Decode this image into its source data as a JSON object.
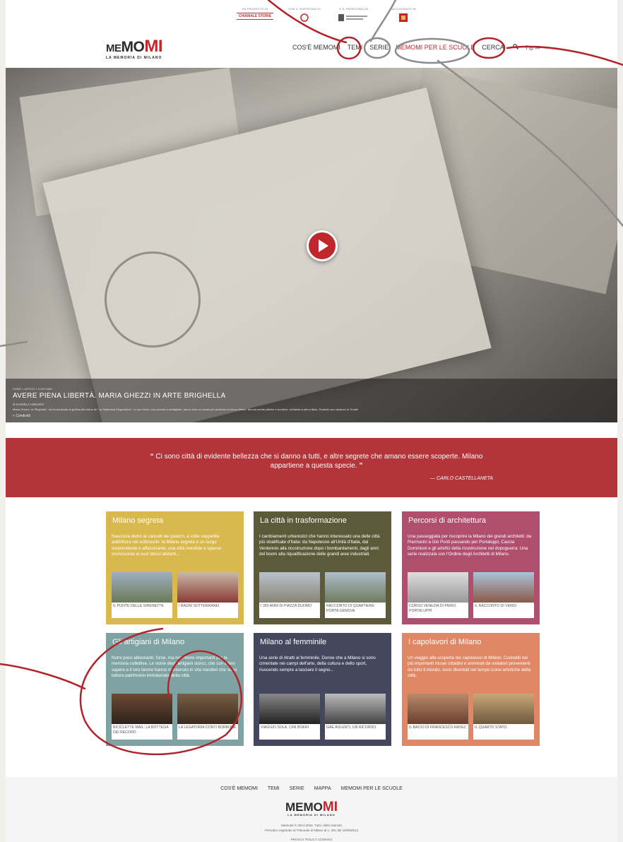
{
  "sponsors": [
    {
      "label": "UN PROGETTO DI",
      "logo": "CHIAMALE STORIE"
    },
    {
      "label": "CON IL SOSTEGNO DI",
      "logo": ""
    },
    {
      "label": "E IL PATROCINIO DI",
      "logo": ""
    },
    {
      "label": "SELEZIONATO IN",
      "logo": ""
    }
  ],
  "brand": {
    "me": "ME",
    "mo": "MO",
    "mi": "MI",
    "subtitle": "LA MEMORIA DI MILANO"
  },
  "nav": {
    "items": [
      "COS'È MEMOMI",
      "TEMI",
      "SERIE",
      "MEMOMI PER LE SCUOLE",
      "CERCA"
    ]
  },
  "hero": {
    "crumbs": "HOME  »  ARTISTI  »  COSTUME",
    "title": "AVERE PIENA LIBERTÀ. MARIA GHEZZI IN ARTE BRIGHELLA",
    "byline": "di DANIELA ANNARO",
    "excerpt": "Maria Ghezzi, la \"Brighella\", ha rivoluzionato la grafica dei rebus de \"La Settimana Enigmistica\". Le sue chine, così precise e dettagliate, hanno dato un senso più profondo al rebus stesso. Ma era anche pittrice e scultrice: un'artista a pieno titolo. Durante una vacanza in Trentin",
    "share": "Condividi"
  },
  "quote": {
    "text": "Ci sono città di evidente bellezza che si danno a tutti, e altre segrete che amano essere scoperte. Milano appartiene a questa specie.",
    "author": "— CARLO CASTELLANETA"
  },
  "cards": [
    {
      "title": "Milano segreta",
      "color": "#d9b84e",
      "desc": "Nascosta dietro ai cancelli dei palazzi, a volte seppellita addirittura nel sottosuolo: la Milano segreta è un luogo sorprendente e affascinante, una città invisibile e spesso sconosciuta ai suoi stessi abitanti...",
      "thumbs": [
        "IL PONTE DELLE SIRENETTE",
        "I BAGNI SOTTERRANEI"
      ]
    },
    {
      "title": "La città in trasformazione",
      "color": "#5d5a3a",
      "desc": "I cambiamenti urbanistici che hanno interessato una delle città più stratificate d'Italia: da Napoleone all'Unità d'Italia, dal Ventennio alla ricostruzione dopo i bombardamenti, dagli anni del boom alla riqualificazione delle grandi aree industriali.",
      "thumbs": [
        "I 350 ANNI DI PIAZZA DUOMO",
        "RACCONTO DI QUARTIERE: PORTA GENOVA"
      ]
    },
    {
      "title": "Percorsi di architettura",
      "color": "#b04e6e",
      "desc": "Una passeggiata per riscoprire la Milano dei grandi architetti: da Piermarini a Giò Ponti passando per Portaluppi, Caccia Dominioni e gli artefici della ricostruzione nel dopoguerra. Una serie realizzata con l'Ordine degli Architetti di Milano.",
      "thumbs": [
        "CORSO VENEZIA DI PIERO PORTALUPPI",
        "IL RACCONTO DI VERDI"
      ]
    },
    {
      "title": "Gli artigiani di Milano",
      "color": "#7ea3a2",
      "desc": "Nomi poco altisonanti, forse, ma non meno importanti per la memoria collettiva. Le storie degli artigiani storici, che con il loro sapere e il loro lavoro hanno mantenuto in vita mestieri che sono tuttora patrimonio immateriale della città.",
      "thumbs": [
        "BICICLETTE MAIL: LA BOTTEGA DEI RECORD",
        "LA LEGATORIA CONTI BORBONE"
      ]
    },
    {
      "title": "Milano al femminile",
      "color": "#45475f",
      "desc": "Una serie di ritratti al femminile. Donne che a Milano si sono cimentate nei campi dell'arte, della cultura e dello sport, riuscendo sempre a lasciare il segno...",
      "thumbs": [
        "VIAGGIO SOLA, CINI BOERI",
        "GAE AULENTI, UN RICORDO"
      ]
    },
    {
      "title": "I capolavori di Milano",
      "color": "#e08866",
      "desc": "Un viaggio alla scoperta dei capolavori di Milano. Custoditi nei più importanti musei cittadini e ammirati da visitatori provenienti da tutto il mondo, sono diventati nel tempo icone artistiche della città.",
      "thumbs": [
        "IL BACIO DI FRANCESCO HAYEZ",
        "IL QUARTO STATO"
      ]
    }
  ],
  "footer": {
    "nav": [
      "COS'È MEMOMI",
      "TEMI",
      "SERIE",
      "MAPPA",
      "MEMOMI PER LE SCUOLE"
    ],
    "copyright": "MemoMi © 2014-2022. Tutti i diritti riservati",
    "registration": "Periodico registrato al Tribunale di Milano al n. 301 del 16/09/2014",
    "privacy": "PRIVACY POLICY   COOKIES"
  }
}
